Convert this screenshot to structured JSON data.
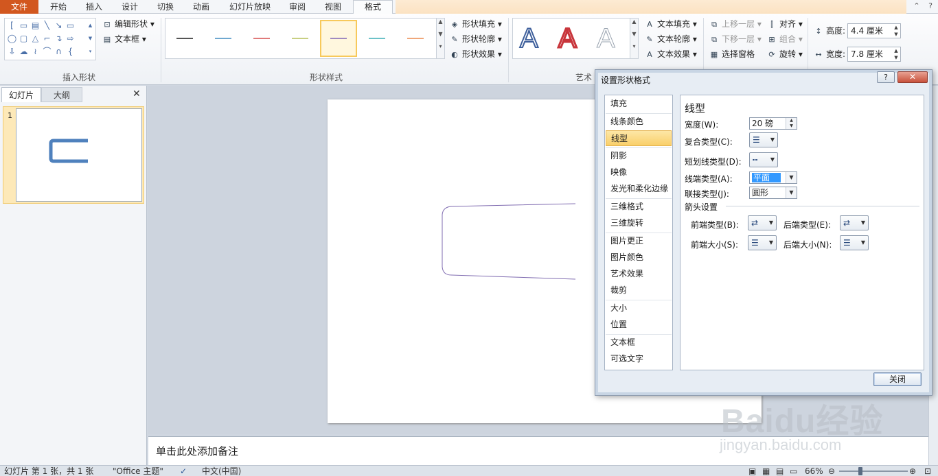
{
  "tabs": {
    "file": "文件",
    "items": [
      "开始",
      "插入",
      "设计",
      "切换",
      "动画",
      "幻灯片放映",
      "审阅",
      "视图"
    ],
    "active": "格式"
  },
  "ribbon": {
    "insert_shape": {
      "edit_shape": "编辑形状",
      "text_box": "文本框",
      "label": "插入形状"
    },
    "shape_styles": {
      "label": "形状样式",
      "fill": "形状填充",
      "outline": "形状轮廓",
      "effect": "形状效果",
      "swatch_colors": [
        "#555555",
        "#6fa8d0",
        "#e07a7a",
        "#c8cf82",
        "#a08ac0",
        "#6cc2c8",
        "#f0a77a"
      ]
    },
    "wordart": {
      "label": "艺术",
      "text_fill": "文本填充",
      "text_outline": "文本轮廓",
      "text_effect": "文本效果",
      "letters": [
        "A",
        "A",
        "A"
      ]
    },
    "arrange": {
      "bring_forward": "上移一层",
      "send_backward": "下移一层",
      "selection_pane": "选择窗格",
      "align": "对齐",
      "group": "组合",
      "rotate": "旋转"
    },
    "size": {
      "height_label": "高度:",
      "height_value": "4.4 厘米",
      "width_label": "宽度:",
      "width_value": "7.8 厘米"
    }
  },
  "left_panel": {
    "tab_slides": "幻灯片",
    "tab_outline": "大纲",
    "close": "✕",
    "slide_number": "1"
  },
  "notes": {
    "placeholder": "单击此处添加备注"
  },
  "status_bar": {
    "slide_info": "幻灯片 第 1 张，共 1 张",
    "theme": "\"Office 主题\"",
    "language": "中文(中国)",
    "zoom": "66%"
  },
  "dialog": {
    "title": "设置形状格式",
    "help": "?",
    "close_x": "✕",
    "nav": [
      "填充",
      "线条颜色",
      "线型",
      "阴影",
      "映像",
      "发光和柔化边缘",
      "三维格式",
      "三维旋转",
      "图片更正",
      "图片颜色",
      "艺术效果",
      "裁剪",
      "大小",
      "位置",
      "文本框",
      "可选文字"
    ],
    "selected_nav": "线型",
    "content": {
      "heading": "线型",
      "width_label": "宽度(W):",
      "width_value": "20 磅",
      "compound_label": "复合类型(C):",
      "dash_label": "短划线类型(D):",
      "cap_label": "线端类型(A):",
      "cap_value": "平面",
      "join_label": "联接类型(J):",
      "join_value": "圆形",
      "arrow_section": "箭头设置",
      "begin_type": "前端类型(B):",
      "end_type": "后端类型(E):",
      "begin_size": "前端大小(S):",
      "end_size": "后端大小(N):"
    },
    "close_button": "关闭"
  },
  "watermark": {
    "brand": "Baidu经验",
    "url": "jingyan.baidu.com"
  }
}
